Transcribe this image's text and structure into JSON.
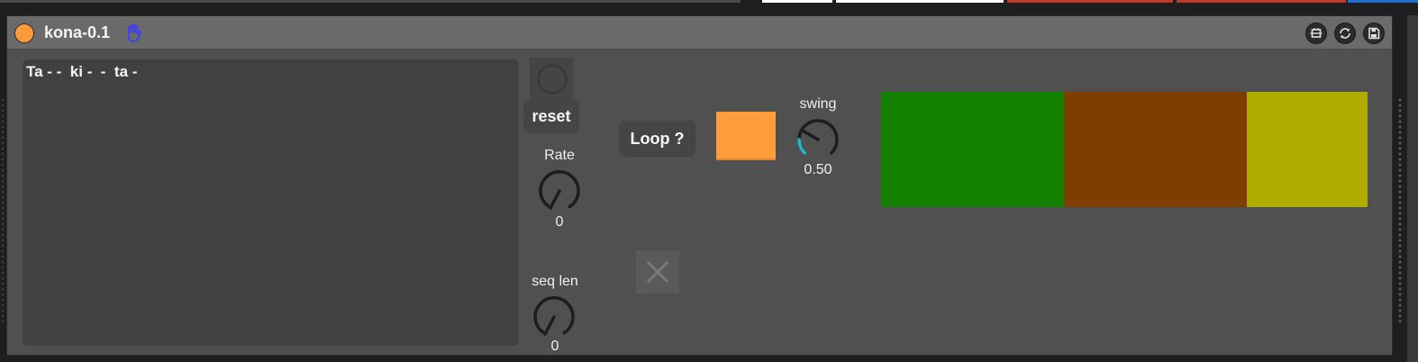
{
  "device": {
    "name": "kona-0.1",
    "power_color": "#ff9a3c",
    "hand_icon": "hand-icon",
    "title_buttons": [
      "hotswap-icon",
      "refresh-icon",
      "save-icon"
    ]
  },
  "sequence_text": "Ta - -  ki -  -  ta -",
  "reset_label": "reset",
  "rate": {
    "label": "Rate",
    "value": "0"
  },
  "seq_len": {
    "label": "seq len",
    "value": "0"
  },
  "loop_label": "Loop ?",
  "loop_toggle_color": "#ff9d3c",
  "swing": {
    "label": "swing",
    "value": "0.50",
    "fraction": 0.5,
    "accent": "#22b5c8"
  },
  "color_cells": [
    {
      "color": "#138000",
      "weight": 203
    },
    {
      "color": "#7e3e00",
      "weight": 203
    },
    {
      "color": "#b0ac00",
      "weight": 134
    }
  ],
  "top_strip": [
    "#4a4a4a",
    "#ffffff",
    "#ffffff",
    "#c0392b",
    "#c0392b",
    "#1f6fd1"
  ]
}
